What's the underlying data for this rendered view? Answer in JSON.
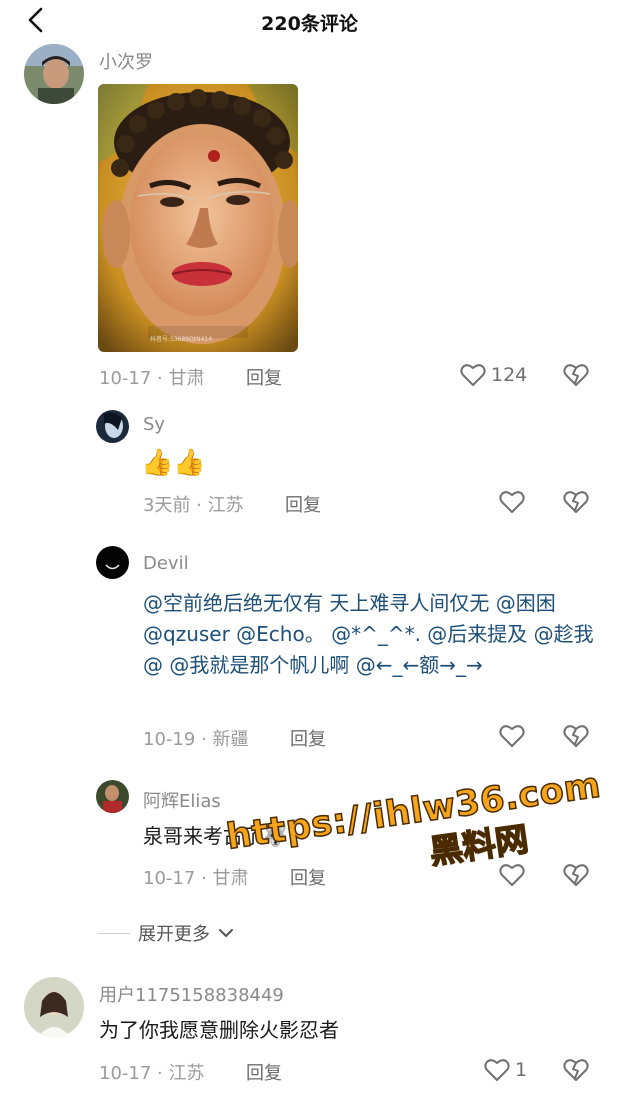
{
  "header": {
    "title": "220条评论",
    "back_icon": "chevron-left-icon"
  },
  "comments": [
    {
      "username": "小次罗",
      "date": "10-17",
      "location": "甘肃",
      "reply_label": "回复",
      "like_count": "124",
      "has_image": true,
      "image_caption": "抖音号:53689DtN414"
    }
  ],
  "replies": [
    {
      "username": "Sy",
      "emoji": "👍👍",
      "date": "3天前",
      "location": "江苏",
      "reply_label": "回复",
      "like_count": ""
    },
    {
      "username": "Devil",
      "text": "@空前绝后绝无仅有 天上难寻人间仅无 @困困 @qzuser @Echo。 @*^_^*. @后来提及 @趁我@ @我就是那个帆儿啊 @←_←额→_→",
      "date": "10-19",
      "location": "新疆",
      "reply_label": "回复",
      "like_count": ""
    },
    {
      "username": "阿辉Elias",
      "text": "泉哥来考古了",
      "emoji": "🐺",
      "date": "10-17",
      "location": "甘肃",
      "reply_label": "回复",
      "like_count": ""
    }
  ],
  "expand": {
    "label": "展开更多"
  },
  "comment2": {
    "username": "用户1175158838449",
    "text": "为了你我愿意删除火影忍者",
    "date": "10-17",
    "location": "江苏",
    "reply_label": "回复",
    "like_count": "1"
  },
  "watermark": {
    "url": "https://ihlw36.com",
    "sub": "黑料网"
  },
  "colors": {
    "mention": "#1d4f78",
    "watermark": "#f4a51c",
    "meta": "#9b9b9b"
  }
}
